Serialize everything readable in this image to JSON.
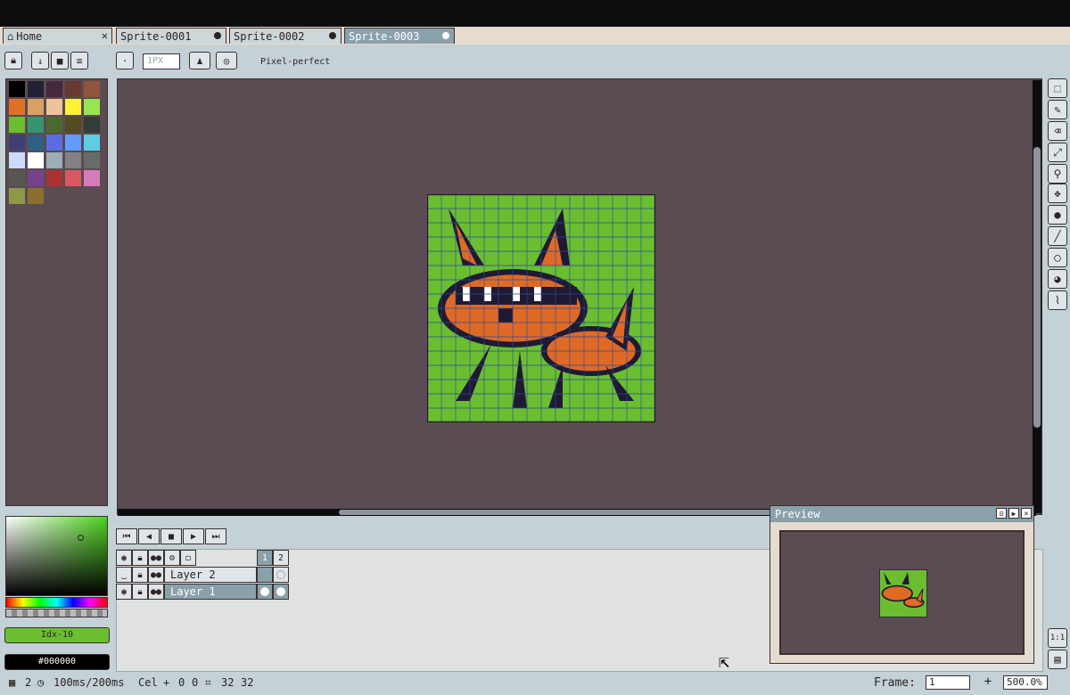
{
  "tabs": [
    {
      "label": "Home",
      "close": "✕"
    },
    {
      "label": "Sprite-0001"
    },
    {
      "label": "Sprite-0002"
    },
    {
      "label": "Sprite-0003"
    }
  ],
  "toolbar": {
    "brush_size": "1PX",
    "pixel_perfect": "Pixel-perfect"
  },
  "palette": {
    "colors": [
      "#000000",
      "#222034",
      "#45283c",
      "#663931",
      "#8f563b",
      "#df7126",
      "#d9a066",
      "#eec39a",
      "#fbf236",
      "#99e550",
      "#6abe30",
      "#37946e",
      "#4b692f",
      "#524b24",
      "#323c39",
      "#3f3f74",
      "#306082",
      "#5b6ee1",
      "#639bff",
      "#5fcde4",
      "#cbdbfc",
      "#ffffff",
      "#9badb7",
      "#847e87",
      "#696a6a",
      "#595652",
      "#76428a",
      "#ac3232",
      "#d95763",
      "#d77bba",
      "#8f974a",
      "#8a6f30"
    ],
    "idx_label": "Idx-10",
    "hex_value": "#000000"
  },
  "preview": {
    "title": "Preview"
  },
  "layers": {
    "frame_numbers": [
      "1",
      "2"
    ],
    "rows": [
      {
        "name": "Layer 2"
      },
      {
        "name": "Layer 1"
      }
    ]
  },
  "status": {
    "frames": "2",
    "duration": "100ms/200ms",
    "cel_label": "Cel",
    "pos_x": "0",
    "pos_y": "0",
    "size_w": "32",
    "size_h": "32",
    "frame_label": "Frame:",
    "frame_value": "1",
    "zoom": "500.0%"
  },
  "colors": {
    "canvas_bg": "#5b4b52",
    "ui_bg": "#c4d1d6",
    "sprite_green": "#6abe30",
    "sprite_orange": "#df6a26",
    "outline": "#1f1a33"
  },
  "icons": [
    "home-icon",
    "lock-icon",
    "arrow-down-icon",
    "stop-icon",
    "menu-icon",
    "brush-icon",
    "ink-icon",
    "symmetry-icon",
    "marquee-icon",
    "pencil-icon",
    "eraser-icon",
    "eyedropper-icon",
    "zoom-icon",
    "move-icon",
    "fill-icon",
    "line-icon",
    "ellipse-icon",
    "blur-icon",
    "smudge-icon",
    "first-frame-icon",
    "prev-frame-icon",
    "play-icon",
    "next-frame-icon",
    "last-frame-icon",
    "eye-icon",
    "timeline-icon",
    "cursor-icon"
  ]
}
